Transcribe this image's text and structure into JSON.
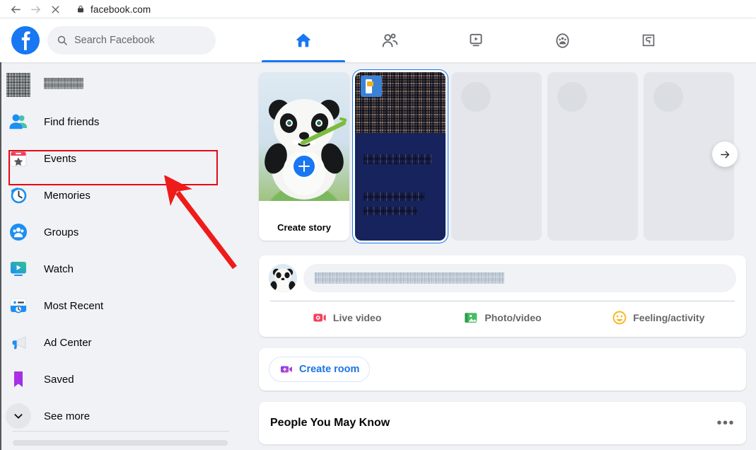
{
  "browser": {
    "back_icon": "arrow-left-icon",
    "forward_icon": "arrow-right-icon",
    "stop_icon": "close-icon",
    "lock_icon": "lock-icon",
    "url": "facebook.com"
  },
  "header": {
    "logo": "facebook-logo",
    "search": {
      "icon": "search-icon",
      "placeholder": "Search Facebook",
      "value": ""
    },
    "tabs": [
      {
        "name": "home",
        "icon": "home-icon",
        "active": true
      },
      {
        "name": "friends",
        "icon": "friends-icon",
        "active": false
      },
      {
        "name": "watch",
        "icon": "watch-icon",
        "active": false
      },
      {
        "name": "groups",
        "icon": "groups-icon",
        "active": false
      },
      {
        "name": "gaming",
        "icon": "gaming-icon",
        "active": false
      }
    ],
    "accent_color": "#1877f2"
  },
  "sidebar": {
    "profile": {
      "label": "",
      "redacted": true
    },
    "items": [
      {
        "label": "Find friends",
        "icon": "find-friends-icon"
      },
      {
        "label": "Events",
        "icon": "events-icon"
      },
      {
        "label": "Memories",
        "icon": "memories-icon"
      },
      {
        "label": "Groups",
        "icon": "groups-icon"
      },
      {
        "label": "Watch",
        "icon": "watch-icon"
      },
      {
        "label": "Most Recent",
        "icon": "most-recent-icon"
      },
      {
        "label": "Ad Center",
        "icon": "ad-center-icon"
      },
      {
        "label": "Saved",
        "icon": "saved-icon"
      },
      {
        "label": "See more",
        "icon": "chevron-down-icon"
      }
    ],
    "highlight": {
      "target": "Events",
      "color": "#e50914"
    }
  },
  "annotation": {
    "arrow_color": "#ef1b1b",
    "points_to": "Events"
  },
  "feed": {
    "stories": {
      "next_icon": "arrow-right-icon",
      "cards": [
        {
          "type": "create",
          "label": "Create story",
          "add_icon": "plus-icon"
        },
        {
          "type": "photo",
          "label": "",
          "redacted": true
        },
        {
          "type": "placeholder",
          "label": ""
        },
        {
          "type": "placeholder",
          "label": ""
        },
        {
          "type": "placeholder",
          "label": ""
        }
      ]
    },
    "composer": {
      "avatar": "user-avatar",
      "input_placeholder": "",
      "input_redacted": true,
      "actions": [
        {
          "label": "Live video",
          "icon": "live-video-icon",
          "color": "#f3425f"
        },
        {
          "label": "Photo/video",
          "icon": "photo-video-icon",
          "color": "#45bd62"
        },
        {
          "label": "Feeling/activity",
          "icon": "feeling-activity-icon",
          "color": "#f7b928"
        }
      ]
    },
    "room": {
      "label": "Create room",
      "icon": "create-room-icon",
      "color": "#1b74e4"
    },
    "people_you_may_know": {
      "title": "People You May Know",
      "menu_icon": "more-options-icon",
      "menu_label": "•••"
    }
  }
}
